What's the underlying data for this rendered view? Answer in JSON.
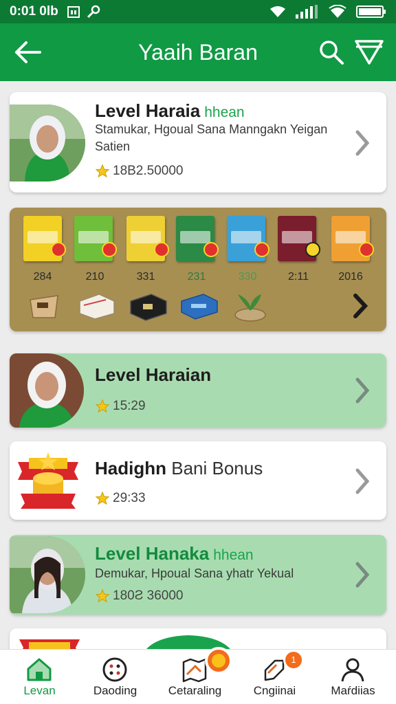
{
  "status": {
    "time": "0:01 0lb"
  },
  "header": {
    "title": "Yaaih Baran"
  },
  "cards": [
    {
      "title": "Level Haraia",
      "highlight": "hhean",
      "subtitle": "Stamukar, Hgoual Sana Manngakn Yeigan Satien",
      "rating": "18B2.50000"
    },
    {
      "title": "Level Haraian",
      "rating": "15:29"
    },
    {
      "title": "Hadighn",
      "title_rest": "Bani Bonus",
      "rating": "29:33"
    },
    {
      "title": "Level Hanaka",
      "highlight": "hhean",
      "subtitle": "Demukar, Hpoual Sana yhatr Yekual",
      "rating": "180Ƨ 36000"
    }
  ],
  "shelf": {
    "counts": [
      "284",
      "210",
      "331",
      "231",
      "330",
      "2:11",
      "2016"
    ]
  },
  "tabs": [
    {
      "label": "Levan"
    },
    {
      "label": "Daoding"
    },
    {
      "label": "Cetaraling"
    },
    {
      "label": "Cngiinai",
      "badge": "1"
    },
    {
      "label": "Maŕdiias"
    }
  ],
  "colors": {
    "brand": "#109a44",
    "status_bar": "#0d7a34",
    "card_green": "#a8dcb0",
    "badge": "#f26c1b",
    "star": "#f5c518"
  },
  "icons": [
    "back-arrow-icon",
    "search-icon",
    "filter-icon",
    "chevron-right-icon",
    "star-icon",
    "home-icon",
    "dots-circle-icon",
    "map-icon",
    "rocket-icon",
    "person-icon"
  ]
}
